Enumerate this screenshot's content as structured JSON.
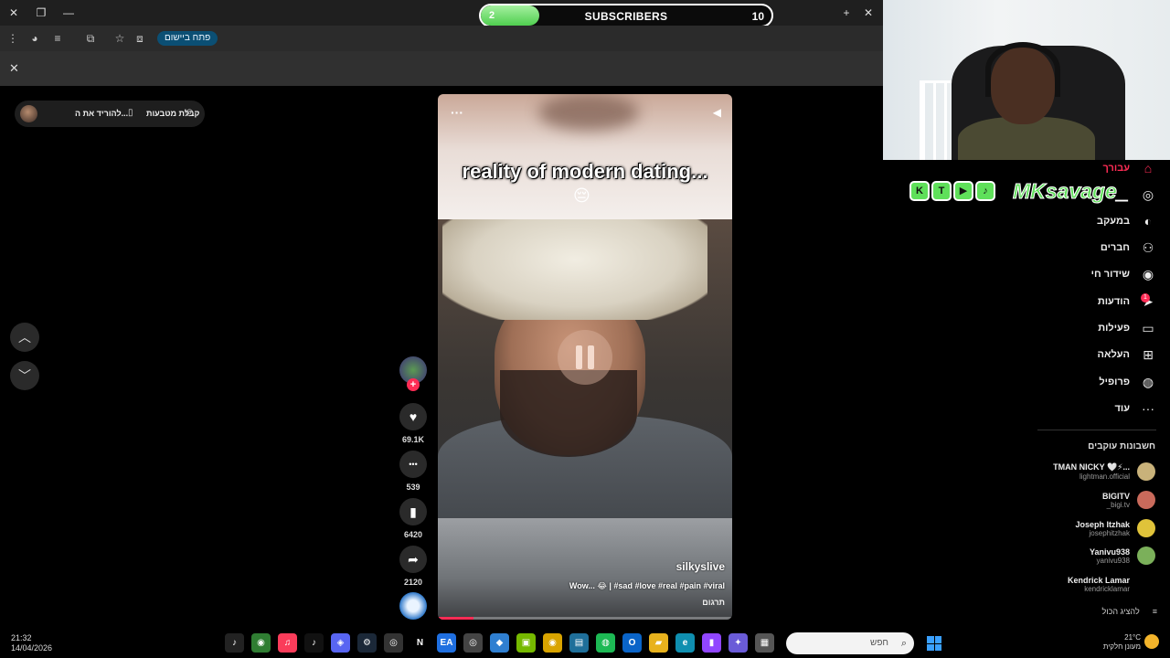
{
  "browser": {
    "open_app_label": "פתח ביישום",
    "tab_controls": {
      "close": "✕",
      "restore": "❐",
      "minimize": "—",
      "new_tab": "+"
    },
    "infobar_close": "✕"
  },
  "sub_goal": {
    "current": "2",
    "label": "SUBSCRIBERS",
    "goal": "10",
    "progress_fraction": 0.2
  },
  "left_panel": {
    "coin_label": "קבלת מטבעות",
    "download_label": "להוריד את ה..."
  },
  "video": {
    "caption": "reality of modern dating...",
    "caption_emoji": "😔",
    "menu": "···",
    "author": "silkyslive",
    "description": "Wow... 😂 | #sad #love #real #pain #viral",
    "translate": "תרגום",
    "progress_fraction": 0.12
  },
  "actions": [
    {
      "name": "like",
      "icon": "♥",
      "count": "69.1K"
    },
    {
      "name": "comment",
      "icon": "•••",
      "count": "539"
    },
    {
      "name": "bookmark",
      "icon": "▮",
      "count": "6420"
    },
    {
      "name": "share",
      "icon": "➦",
      "count": "2120"
    }
  ],
  "follow_plus": "+",
  "brand": {
    "icons": [
      "K",
      "T",
      "▶",
      "♪"
    ],
    "text": "MKsavage_"
  },
  "sidebar": {
    "items": [
      {
        "label": "עבורך",
        "icon": "⌂",
        "active": true
      },
      {
        "label": "",
        "icon": "◎",
        "active": false
      },
      {
        "label": "במעקב",
        "icon": "◐",
        "active": false
      },
      {
        "label": "חברים",
        "icon": "⚇",
        "active": false
      },
      {
        "label": "שידור חי",
        "icon": "◉",
        "active": false
      },
      {
        "label": "הודעות",
        "icon": "➤",
        "active": false
      },
      {
        "label": "פעילות",
        "icon": "▭",
        "active": false
      },
      {
        "label": "העלאה",
        "icon": "⊞",
        "active": false
      },
      {
        "label": "פרופיל",
        "icon": "◍",
        "active": false
      },
      {
        "label": "עוד",
        "icon": "···",
        "active": false
      }
    ],
    "messages_badge": "1",
    "following_title": "חשבונות עוקבים",
    "accounts": [
      {
        "name": "TMAN NICKY 🤍⚡...",
        "handle": "lightman.official",
        "color": "#c9b27a"
      },
      {
        "name": "BIGITV",
        "handle": "_bigi.tv",
        "color": "#c96a5b"
      },
      {
        "name": "Joseph Itzhak",
        "handle": "josephitzhak",
        "color": "#e0c33a"
      },
      {
        "name": "Yanivu938",
        "handle": "yanivu938",
        "color": "#7bb05a"
      },
      {
        "name": "Kendrick Lamar",
        "handle": "kendricklamar",
        "color": "#000000"
      }
    ],
    "show_all": "להציג הכול"
  },
  "taskbar": {
    "time": "21:32",
    "date": "14/04/2026",
    "search_placeholder": "חפש",
    "weather_temp": "21°C",
    "weather_desc": "מעונן חלקית",
    "apps": [
      {
        "name": "tiktok",
        "glyph": "♪",
        "color": "#222"
      },
      {
        "name": "chrome",
        "glyph": "◉",
        "color": "#2f7d32"
      },
      {
        "name": "music",
        "glyph": "♫",
        "color": "#fa3c5a"
      },
      {
        "name": "tiktok2",
        "glyph": "♪",
        "color": "#111"
      },
      {
        "name": "discord",
        "glyph": "◈",
        "color": "#5865f2"
      },
      {
        "name": "steam",
        "glyph": "⚙",
        "color": "#1b2838"
      },
      {
        "name": "obs",
        "glyph": "◎",
        "color": "#333"
      },
      {
        "name": "netflix",
        "glyph": "N",
        "color": "#000"
      },
      {
        "name": "ea",
        "glyph": "EA",
        "color": "#1f6fe0"
      },
      {
        "name": "app-circle",
        "glyph": "◎",
        "color": "#444"
      },
      {
        "name": "vscode",
        "glyph": "◆",
        "color": "#2f7fd1"
      },
      {
        "name": "nvidia",
        "glyph": "▣",
        "color": "#76b900"
      },
      {
        "name": "chrome2",
        "glyph": "◉",
        "color": "#d9a400"
      },
      {
        "name": "notepad",
        "glyph": "▤",
        "color": "#1f6f9a"
      },
      {
        "name": "spotify",
        "glyph": "◍",
        "color": "#1db954"
      },
      {
        "name": "outlook",
        "glyph": "O",
        "color": "#0a64c8"
      },
      {
        "name": "explorer",
        "glyph": "▰",
        "color": "#e8b21d"
      },
      {
        "name": "edge",
        "glyph": "e",
        "color": "#0f8fb0"
      },
      {
        "name": "twitch",
        "glyph": "▮",
        "color": "#9146ff"
      },
      {
        "name": "copilot",
        "glyph": "✦",
        "color": "#6a5bd8"
      },
      {
        "name": "store",
        "glyph": "▦",
        "color": "#555"
      }
    ]
  }
}
